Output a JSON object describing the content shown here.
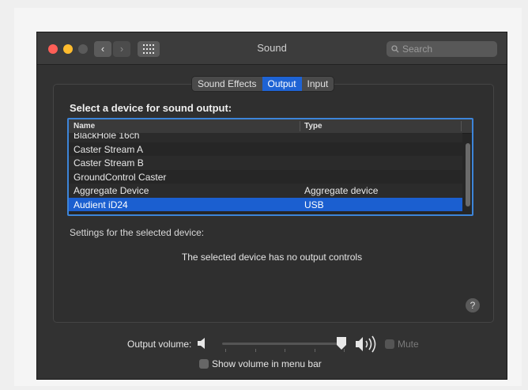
{
  "window": {
    "title": "Sound"
  },
  "search": {
    "placeholder": "Search"
  },
  "tabs": [
    {
      "label": "Sound Effects",
      "active": false
    },
    {
      "label": "Output",
      "active": true
    },
    {
      "label": "Input",
      "active": false
    }
  ],
  "output": {
    "section_title": "Select a device for sound output:",
    "columns": {
      "name": "Name",
      "type": "Type"
    },
    "devices": [
      {
        "name": "BlackHole 16ch",
        "type": ""
      },
      {
        "name": "Caster Stream A",
        "type": ""
      },
      {
        "name": "Caster Stream B",
        "type": ""
      },
      {
        "name": "GroundControl Caster",
        "type": ""
      },
      {
        "name": "Aggregate Device",
        "type": "Aggregate device"
      },
      {
        "name": "Audient iD24",
        "type": "USB",
        "selected": true
      }
    ],
    "settings_label": "Settings for the selected device:",
    "no_controls_message": "The selected device has no output controls"
  },
  "volume": {
    "label": "Output volume:",
    "level": 0.92,
    "mute_label": "Mute",
    "mute_checked": false,
    "show_in_menu_bar_label": "Show volume in menu bar",
    "show_in_menu_bar_checked": false
  },
  "help": {
    "label": "?"
  },
  "colors": {
    "accent": "#1b5fd0",
    "window_bg": "#323232"
  }
}
